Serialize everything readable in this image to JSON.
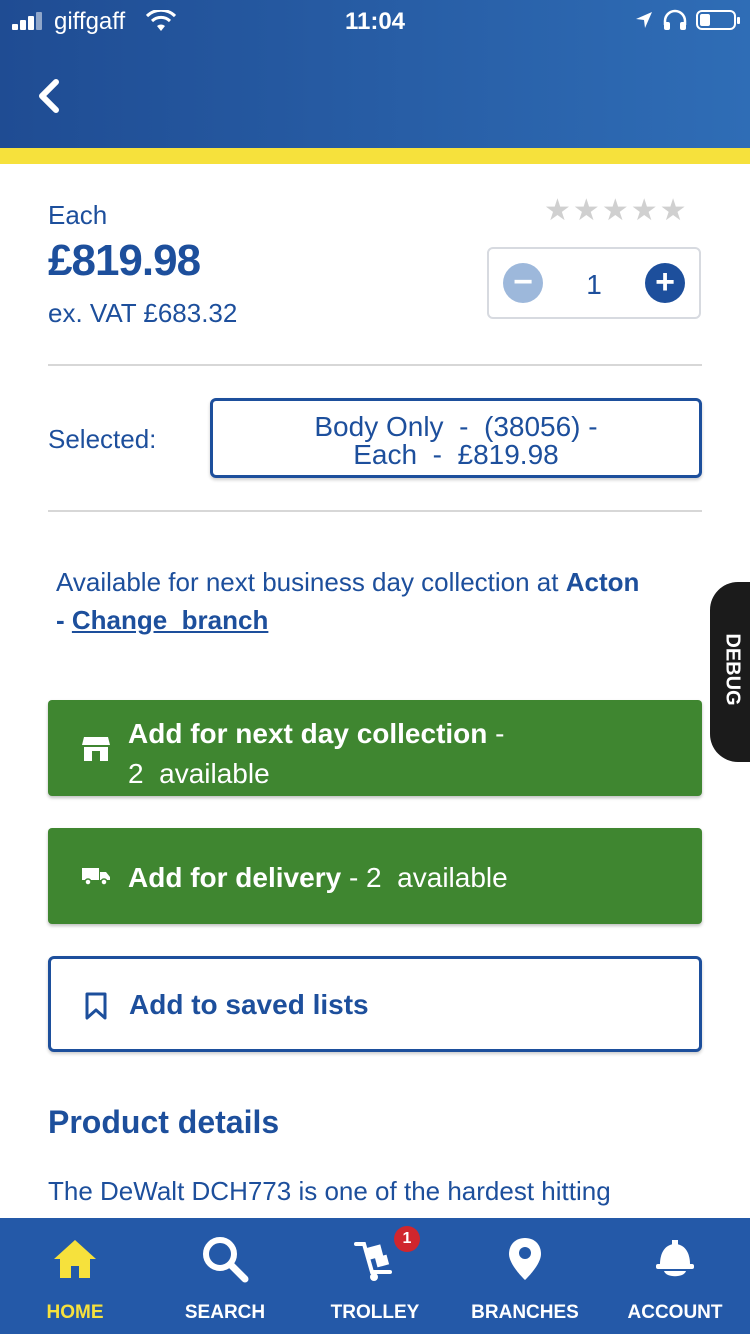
{
  "status_bar": {
    "carrier": "giffgaff",
    "time": "11:04"
  },
  "product": {
    "unit_label": "Each",
    "price": "£819.98",
    "ex_vat": "ex. VAT £683.32",
    "rating_stars": 5,
    "rating_filled": 0,
    "quantity": "1"
  },
  "selection": {
    "label": "Selected:",
    "line1": "Body Only  -  (38056) -",
    "line2": "Each  -  £819.98"
  },
  "availability": {
    "prefix": "Available for next business day collection at ",
    "branch": "Acton",
    "separator": "- ",
    "change_link": "Change  branch"
  },
  "debug_tab": "DEBUG",
  "buttons": {
    "collection_title": "Add for next day collection",
    "collection_suffix": " -",
    "collection_available": "2  available",
    "delivery_title": "Add for delivery",
    "delivery_available": " - 2  available",
    "saved_lists": "Add to saved lists"
  },
  "details": {
    "title": "Product details",
    "description": "The DeWalt DCH773 is one of the hardest hitting"
  },
  "tabbar": {
    "items": [
      {
        "label": "HOME",
        "icon": "home-icon",
        "active": true
      },
      {
        "label": "SEARCH",
        "icon": "search-icon",
        "active": false
      },
      {
        "label": "TROLLEY",
        "icon": "trolley-icon",
        "active": false
      },
      {
        "label": "BRANCHES",
        "icon": "location-pin-icon",
        "active": false
      },
      {
        "label": "ACCOUNT",
        "icon": "hard-hat-icon",
        "active": false
      }
    ],
    "trolley_badge": "1"
  },
  "colors": {
    "brand_blue": "#1d4f9c",
    "header_blue": "#2459a8",
    "accent_yellow": "#f6e13c",
    "button_green": "#3f8630",
    "badge_red": "#d0262d"
  }
}
